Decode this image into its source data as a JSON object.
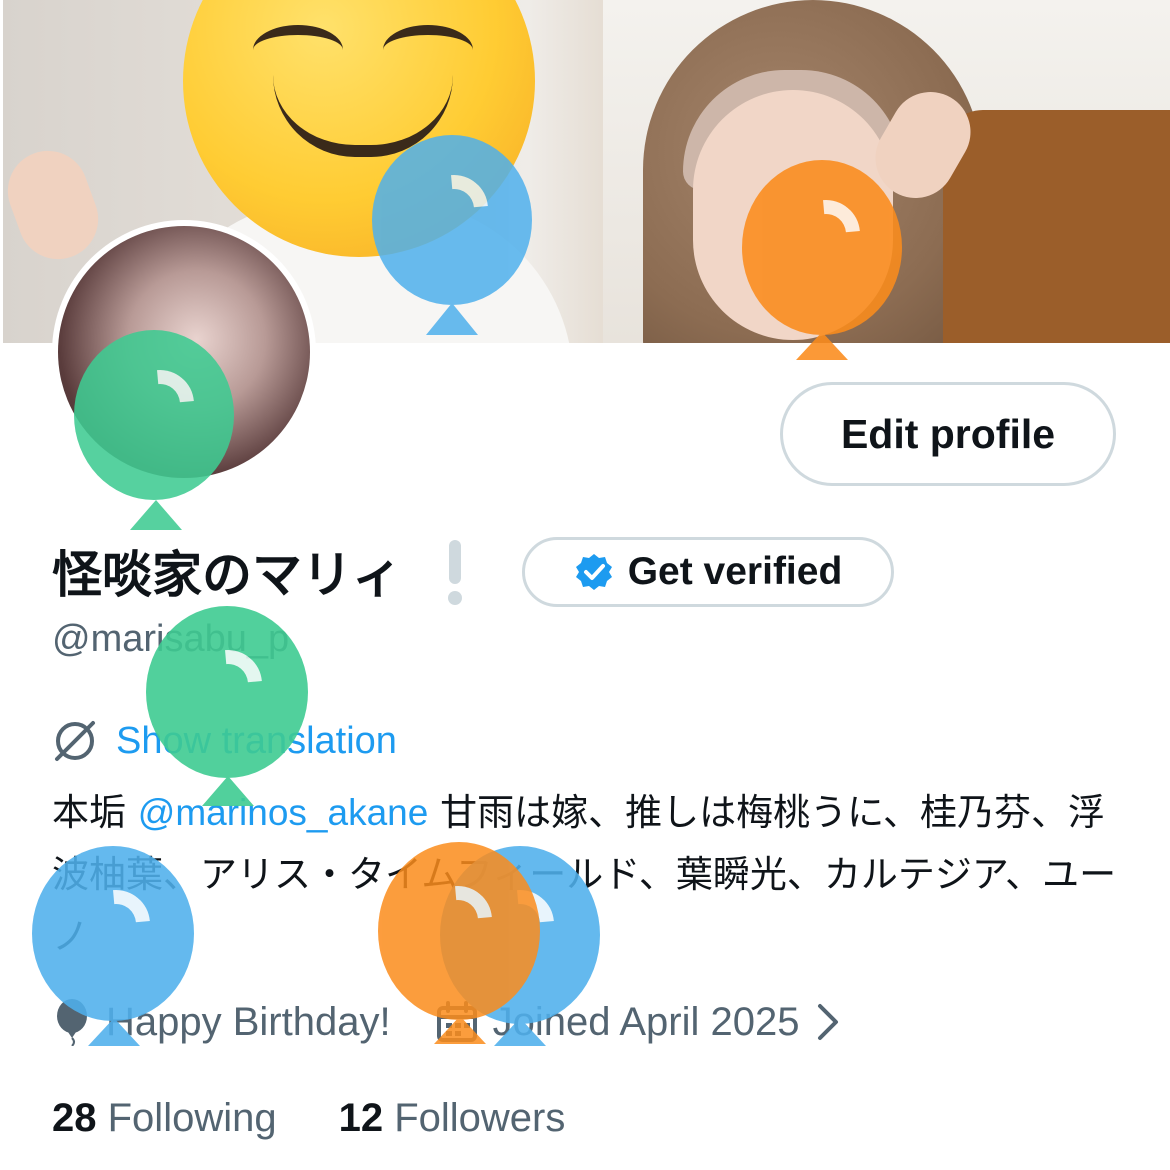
{
  "profile": {
    "display_name": "怪啖家のマリィ",
    "handle": "@marisabu_p",
    "edit_profile_label": "Edit profile",
    "get_verified_label": "Get verified"
  },
  "translation": {
    "label": "Show translation"
  },
  "bio": {
    "prefix": "本垢 ",
    "mention": "@marinos_akane",
    "text": " 甘雨は嫁、推しは梅桃うに、桂乃芬、浮波柚葉、アリス・タイムフィールド、葉瞬光、カルテジア、ユーノ"
  },
  "meta": {
    "birthday": "Happy Birthday!",
    "joined": "Joined April 2025"
  },
  "stats": {
    "following_count": "28",
    "following_label": "Following",
    "followers_count": "12",
    "followers_label": "Followers"
  },
  "colors": {
    "accent": "#1d9bf0",
    "secondary_text": "#536471",
    "balloon_blue": "#4fb0ec",
    "balloon_orange": "#fb8c1c",
    "balloon_green": "#3fcb92"
  },
  "icons": {
    "translate": "translate-icon",
    "birthday": "balloon-icon",
    "calendar": "calendar-icon",
    "chevron": "chevron-right-icon",
    "verified": "verified-badge-icon"
  }
}
